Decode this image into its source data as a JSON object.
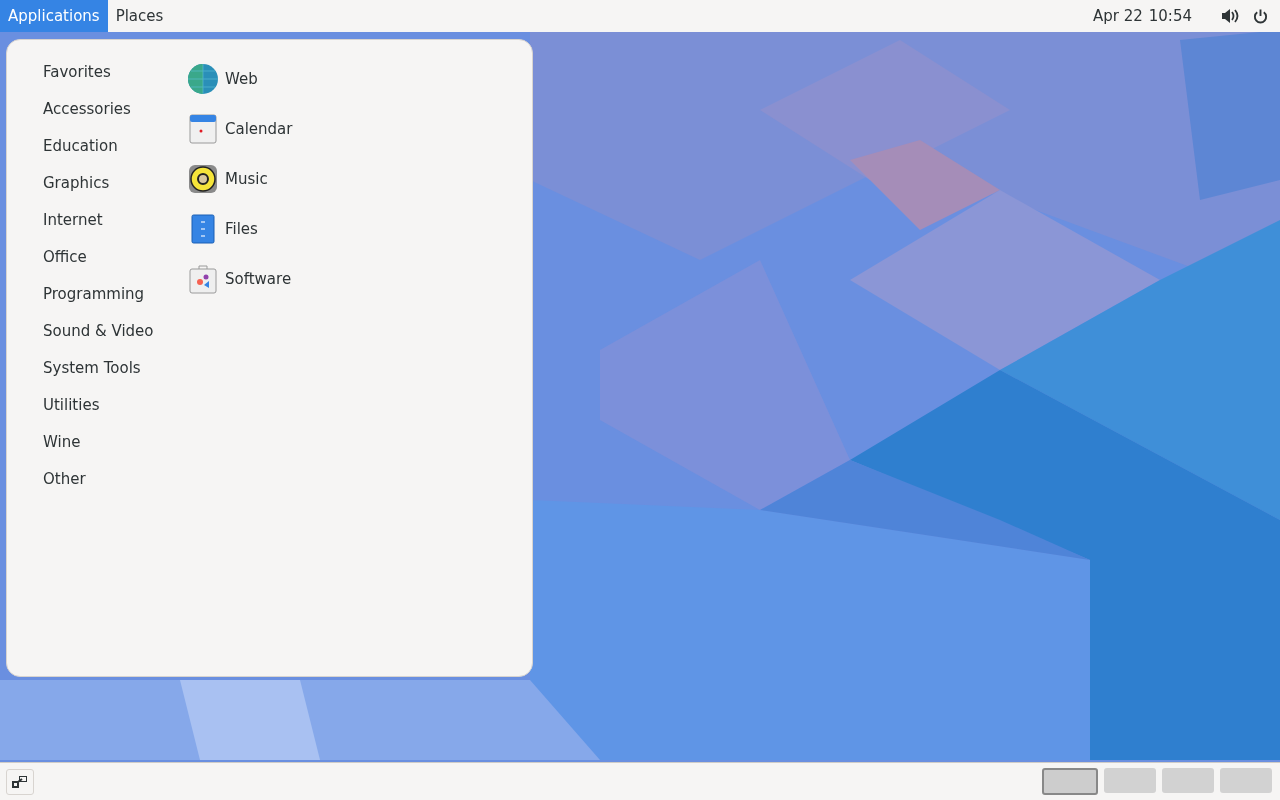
{
  "top_bar": {
    "menus": [
      {
        "label": "Applications",
        "selected": true
      },
      {
        "label": "Places",
        "selected": false
      }
    ],
    "clock": {
      "date": "Apr 22",
      "time": "10:54"
    }
  },
  "applications_menu": {
    "categories": [
      {
        "label": "Favorites"
      },
      {
        "label": "Accessories"
      },
      {
        "label": "Education"
      },
      {
        "label": "Graphics"
      },
      {
        "label": "Internet"
      },
      {
        "label": "Office"
      },
      {
        "label": "Programming"
      },
      {
        "label": "Sound & Video"
      },
      {
        "label": "System Tools"
      },
      {
        "label": "Utilities"
      },
      {
        "label": "Wine"
      },
      {
        "label": "Other"
      }
    ],
    "apps": [
      {
        "label": "Web",
        "kind": "globe"
      },
      {
        "label": "Calendar",
        "kind": "calendar"
      },
      {
        "label": "Music",
        "kind": "speaker"
      },
      {
        "label": "Files",
        "kind": "files"
      },
      {
        "label": "Software",
        "kind": "bag"
      }
    ]
  },
  "bottom_bar": {
    "workspaces": [
      {
        "selected": true
      },
      {
        "selected": false
      },
      {
        "selected": false
      },
      {
        "selected": false
      }
    ]
  }
}
